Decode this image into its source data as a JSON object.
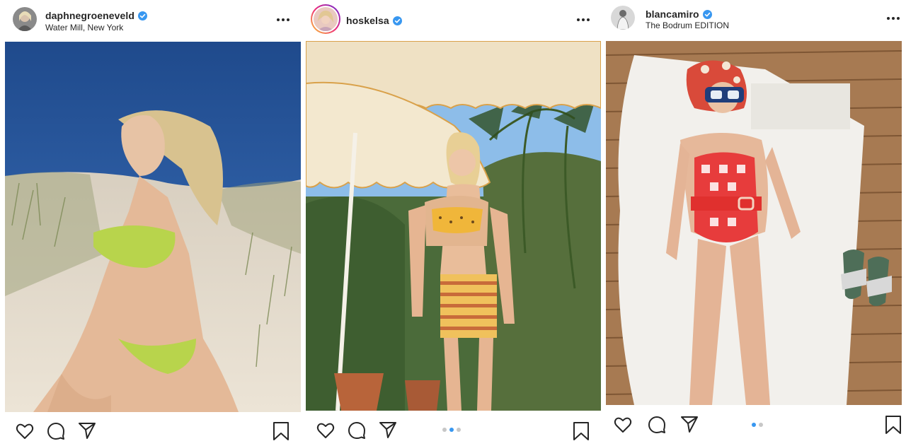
{
  "posts": [
    {
      "username": "daphnegroeneveld",
      "verified": true,
      "location": "Water Mill, New York",
      "more_icon": "more-horizontal-icon",
      "photo": "woman-in-green-bikini-on-sand-dunes",
      "carousel": null
    },
    {
      "username": "hoskelsa",
      "verified": true,
      "location": "",
      "more_icon": "more-horizontal-icon",
      "photo": "woman-in-striped-shorts-under-beach-umbrella",
      "carousel": {
        "count": 3,
        "active_index": 1
      }
    },
    {
      "username": "blancamiro",
      "verified": true,
      "location": "The Bodrum EDITION",
      "more_icon": "more-horizontal-icon",
      "photo": "woman-in-red-gingham-swimsuit-on-lounger",
      "carousel": {
        "count": 2,
        "active_index": 0
      }
    }
  ],
  "icons": {
    "like": "heart-icon",
    "comment": "comment-bubble-icon",
    "share": "paper-plane-icon",
    "save": "bookmark-icon",
    "verified": "verified-badge-icon"
  },
  "colors": {
    "text": "#262626",
    "verified_blue": "#3897f0",
    "carousel_active": "#3897f0",
    "carousel_inactive": "#c7c7c7"
  }
}
